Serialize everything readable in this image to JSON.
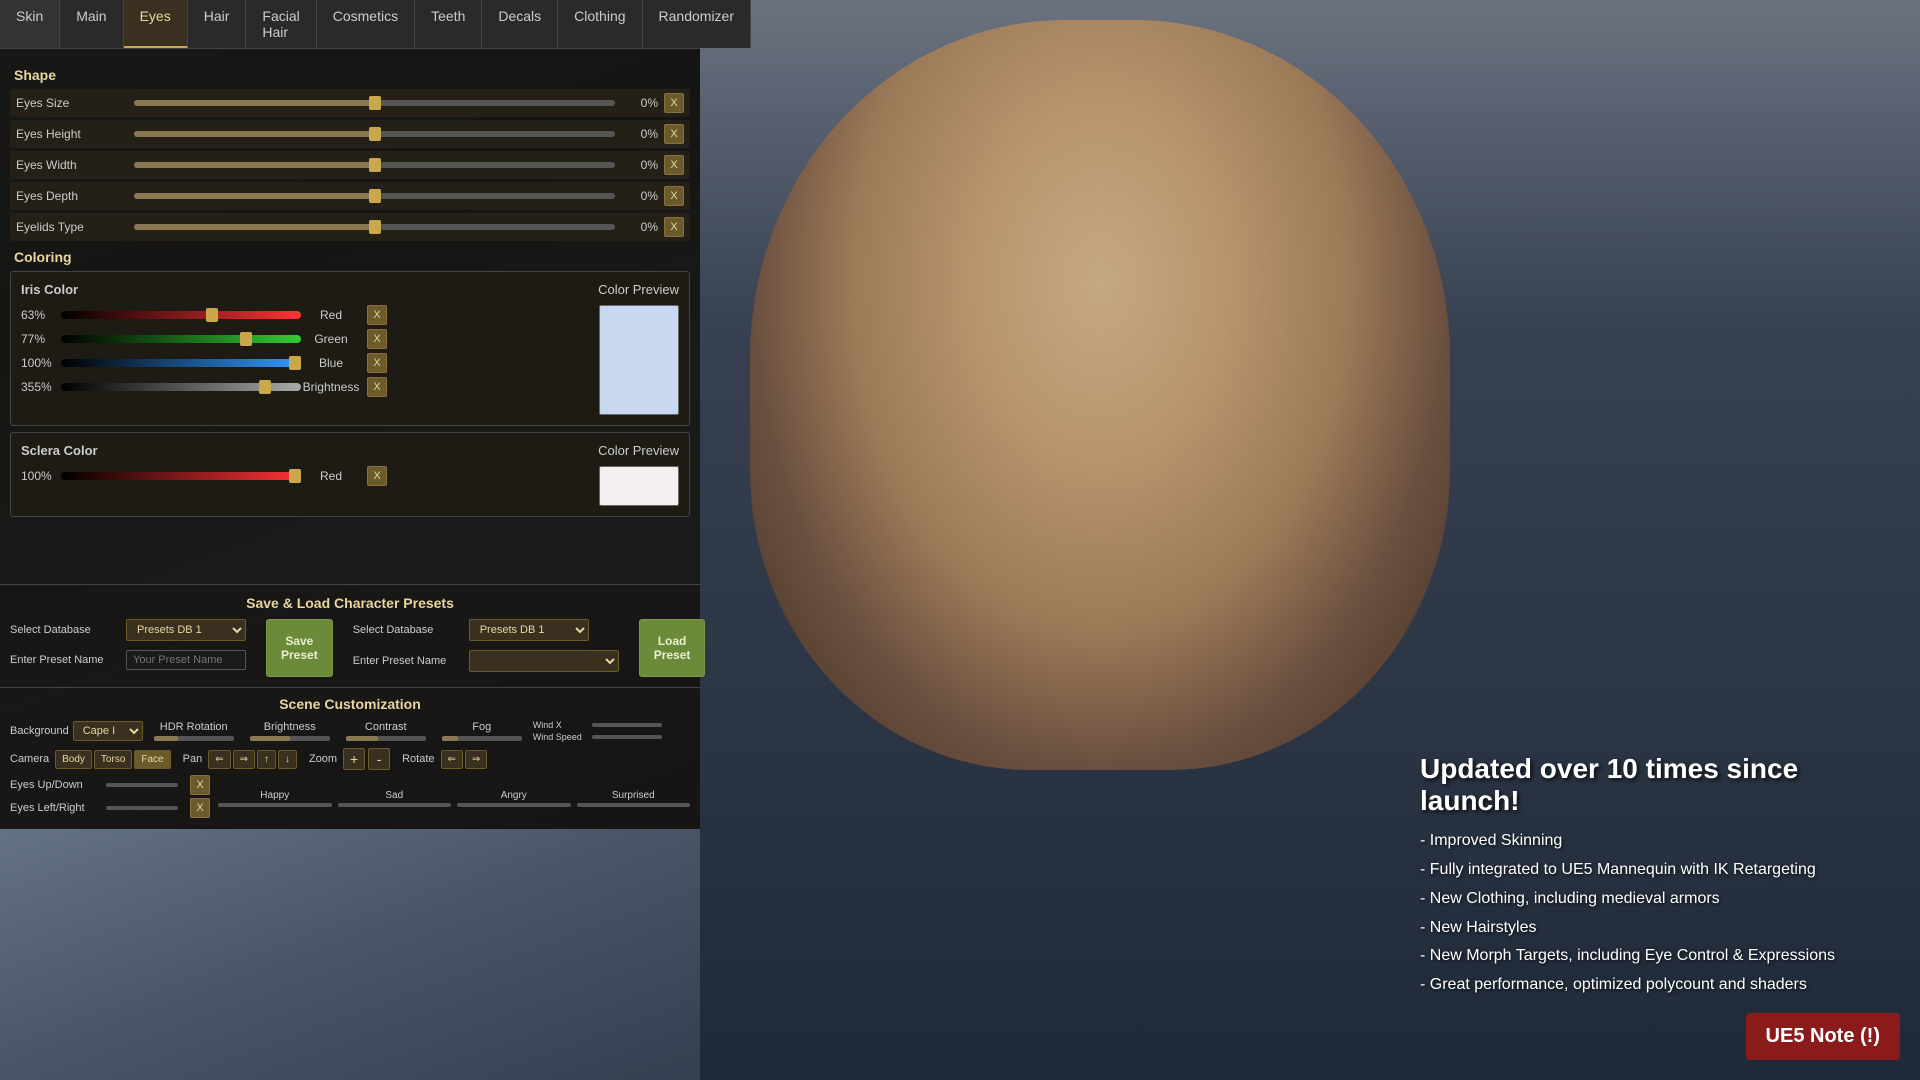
{
  "tabs": {
    "items": [
      {
        "label": "Skin",
        "active": false
      },
      {
        "label": "Main",
        "active": false
      },
      {
        "label": "Eyes",
        "active": true
      },
      {
        "label": "Hair",
        "active": false
      },
      {
        "label": "Facial Hair",
        "active": false
      },
      {
        "label": "Cosmetics",
        "active": false
      },
      {
        "label": "Teeth",
        "active": false
      },
      {
        "label": "Decals",
        "active": false
      },
      {
        "label": "Clothing",
        "active": false
      },
      {
        "label": "Randomizer",
        "active": false
      }
    ]
  },
  "shape_section": {
    "title": "Shape",
    "sliders": [
      {
        "label": "Eyes Size",
        "value": "0%",
        "fill_pct": 50
      },
      {
        "label": "Eyes Height",
        "value": "0%",
        "fill_pct": 50
      },
      {
        "label": "Eyes Width",
        "value": "0%",
        "fill_pct": 50
      },
      {
        "label": "Eyes Depth",
        "value": "0%",
        "fill_pct": 50
      },
      {
        "label": "Eyelids Type",
        "value": "0%",
        "fill_pct": 50
      }
    ]
  },
  "coloring_section": {
    "title": "Coloring",
    "iris": {
      "title": "Iris Color",
      "preview_label": "Color Preview",
      "preview_color": "#c8d8f0",
      "channels": [
        {
          "label": "Red",
          "pct": "63%",
          "fill": 63,
          "type": "red"
        },
        {
          "label": "Green",
          "pct": "77%",
          "fill": 77,
          "type": "green"
        },
        {
          "label": "Blue",
          "pct": "100%",
          "fill": 100,
          "type": "blue"
        },
        {
          "label": "Brightness",
          "pct": "355%",
          "fill": 85,
          "type": "gray"
        }
      ]
    },
    "sclera": {
      "title": "Sclera Color",
      "preview_label": "Color Preview",
      "preview_color": "#f5f0f0",
      "channels": [
        {
          "label": "Red",
          "pct": "100%",
          "fill": 100,
          "type": "red"
        }
      ]
    }
  },
  "save_load": {
    "title": "Save & Load Character Presets",
    "save_db_label": "Select Database",
    "save_db_value": "Presets DB 1",
    "save_name_label": "Enter Preset Name",
    "save_name_placeholder": "Your Preset Name",
    "save_btn_label": "Save\nPreset",
    "load_db_label": "Select Database",
    "load_db_value": "Presets DB 1",
    "load_name_label": "Enter Preset Name",
    "load_btn_label": "Load\nPreset"
  },
  "scene": {
    "title": "Scene Customization",
    "background_label": "Background",
    "background_value": "Cape I",
    "hdr_label": "HDR Rotation",
    "brightness_label": "Brightness",
    "contrast_label": "Contrast",
    "fog_label": "Fog",
    "camera_label": "Camera",
    "cam_body": "Body",
    "cam_torso": "Torso",
    "cam_face": "Face",
    "pan_label": "Pan",
    "zoom_label": "Zoom",
    "zoom_plus": "+",
    "zoom_minus": "-",
    "rotate_label": "Rotate",
    "wind_x_label": "Wind X",
    "wind_speed_label": "Wind Speed",
    "eyes_up_down": "Eyes Up/Down",
    "eyes_left_right": "Eyes Left/Right",
    "expressions": [
      {
        "label": "Happy"
      },
      {
        "label": "Sad"
      },
      {
        "label": "Angry"
      },
      {
        "label": "Surprised"
      }
    ]
  },
  "info": {
    "main_text": "Updated over 10 times since launch!",
    "points": [
      "- Improved Skinning",
      "- Fully integrated to UE5 Mannequin with IK Retargeting",
      "- New Clothing, including medieval armors",
      "- New Hairstyles",
      "- New Morph Targets, including Eye Control & Expressions",
      "- Great performance, optimized polycount and shaders"
    ]
  },
  "ue5_note": {
    "label": "UE5 Note (!)"
  }
}
